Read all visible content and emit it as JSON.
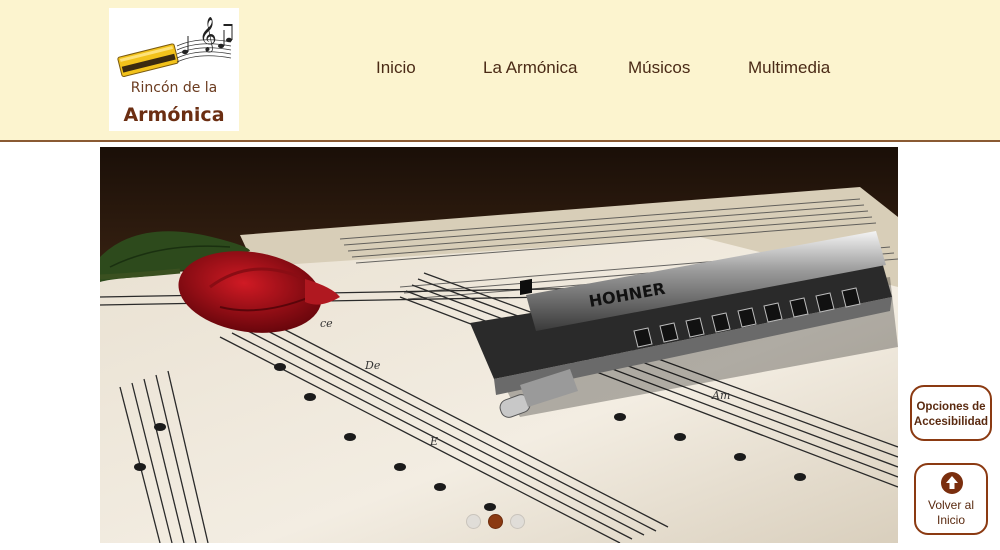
{
  "header": {
    "logo": {
      "line1": "Rincón de la",
      "line2": "Armónica"
    },
    "nav": [
      {
        "label": "Inicio"
      },
      {
        "label": "La Armónica"
      },
      {
        "label": "Músicos"
      },
      {
        "label": "Multimedia"
      }
    ]
  },
  "slider": {
    "image_icon": "harmonica-on-sheet-music-with-rose",
    "embossed_text": "HOHNER",
    "note_labels": [
      "De",
      "E",
      "Am",
      "ce"
    ],
    "active_slide": 2,
    "slide_count": 3
  },
  "accessibility_button": {
    "line1": "Opciones de",
    "line2": "Accesibilidad"
  },
  "back_to_top_button": {
    "line1": "Volver al",
    "line2": "Inicio",
    "icon": "arrow-up-circle-icon"
  },
  "colors": {
    "header_bg": "#fcf4cf",
    "accent": "#8b3a12",
    "text": "#4a2a16"
  }
}
